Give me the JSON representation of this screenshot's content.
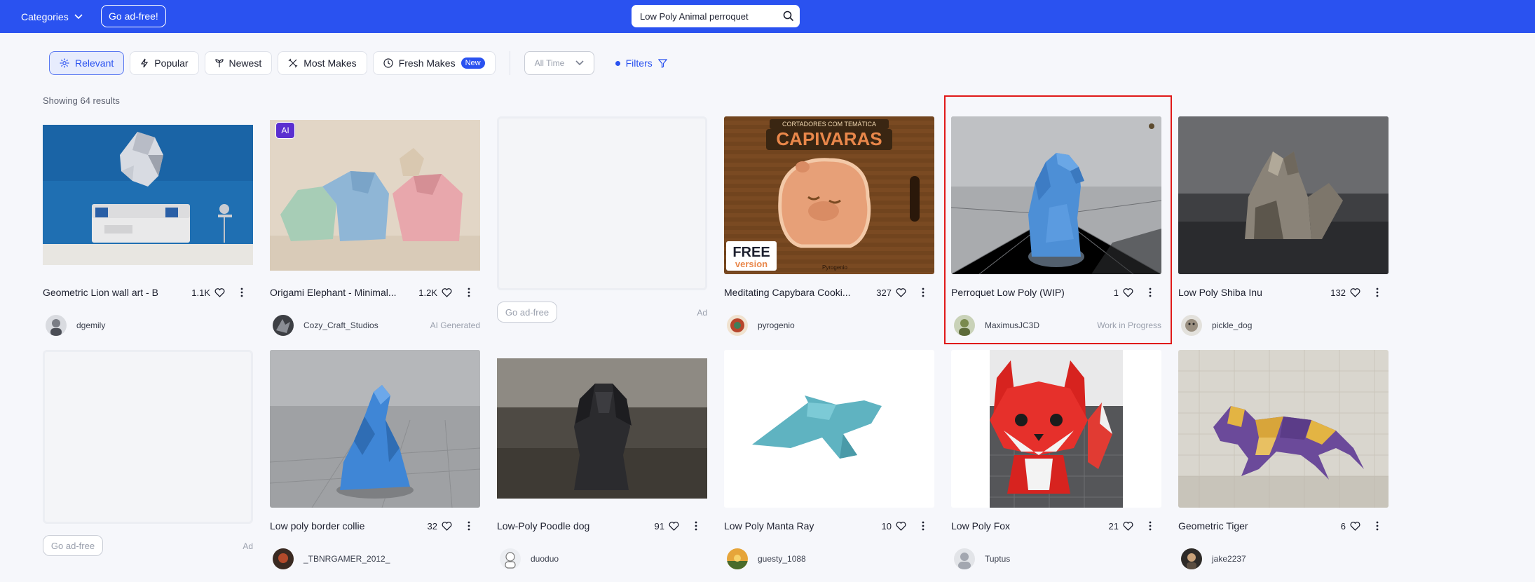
{
  "topbar": {
    "categories_label": "Categories",
    "adfree_label": "Go ad-free!",
    "search_value": "Low Poly Animal perroquet"
  },
  "filters": {
    "tabs": [
      {
        "label": "Relevant",
        "icon": "sparkle-icon",
        "active": true
      },
      {
        "label": "Popular",
        "icon": "lightning-icon",
        "active": false
      },
      {
        "label": "Newest",
        "icon": "sprout-icon",
        "active": false
      },
      {
        "label": "Most Makes",
        "icon": "tools-icon",
        "active": false
      },
      {
        "label": "Fresh Makes",
        "icon": "clock-icon",
        "active": false,
        "badge": "New"
      }
    ],
    "time_select": "All Time",
    "filters_label": "Filters"
  },
  "results_text": "Showing 64 results",
  "ad": {
    "button_label": "Go ad-free",
    "tag": "Ad"
  },
  "cards": [
    {
      "title": "Geometric Lion wall art - B",
      "likes": "1.1K",
      "user": "dgemily",
      "tag": ""
    },
    {
      "title": "Origami Elephant - Minimal...",
      "likes": "1.2K",
      "user": "Cozy_Craft_Studios",
      "tag": "AI Generated",
      "ai_badge": "AI"
    },
    {
      "title": "Meditating Capybara Cooki...",
      "likes": "327",
      "user": "pyrogenio",
      "tag": ""
    },
    {
      "title": "Perroquet Low Poly (WIP)",
      "likes": "1",
      "user": "MaximusJC3D",
      "tag": "Work in Progress"
    },
    {
      "title": "Low Poly Shiba Inu",
      "likes": "132",
      "user": "pickle_dog",
      "tag": ""
    },
    {
      "title": "Low poly border collie",
      "likes": "32",
      "user": "_TBNRGAMER_2012_",
      "tag": ""
    },
    {
      "title": "Low-Poly Poodle dog",
      "likes": "91",
      "user": "duoduo",
      "tag": ""
    },
    {
      "title": "Low Poly Manta Ray",
      "likes": "10",
      "user": "guesty_1088",
      "tag": ""
    },
    {
      "title": "Low Poly Fox",
      "likes": "21",
      "user": "Tuptus",
      "tag": ""
    },
    {
      "title": "Geometric Tiger",
      "likes": "6",
      "user": "jake2237",
      "tag": ""
    }
  ],
  "capybara_image_text": {
    "top": "CORTADORES COM TEMÁTICA",
    "main": "CAPIVARAS",
    "free": "FREE",
    "version": "version",
    "brand": "Pyrogenio"
  },
  "colors": {
    "accent": "#2a52f0",
    "highlight": "#e01919"
  }
}
